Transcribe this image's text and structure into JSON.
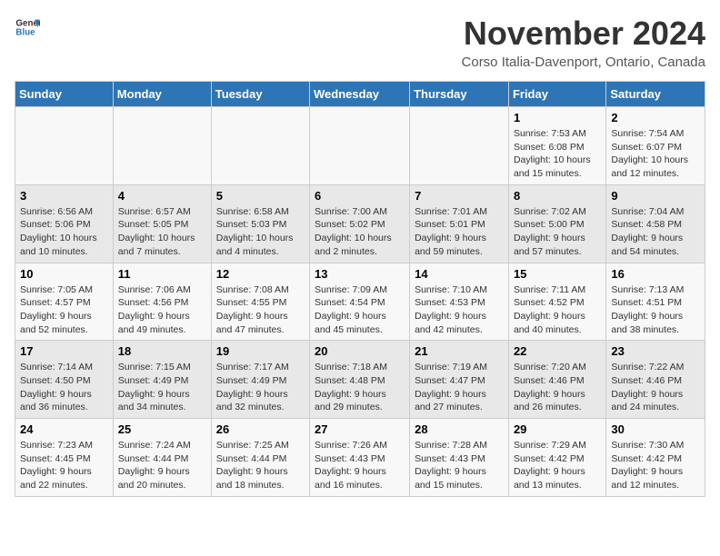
{
  "header": {
    "logo_line1": "General",
    "logo_line2": "Blue",
    "month_title": "November 2024",
    "subtitle": "Corso Italia-Davenport, Ontario, Canada"
  },
  "weekdays": [
    "Sunday",
    "Monday",
    "Tuesday",
    "Wednesday",
    "Thursday",
    "Friday",
    "Saturday"
  ],
  "weeks": [
    [
      {
        "day": "",
        "info": ""
      },
      {
        "day": "",
        "info": ""
      },
      {
        "day": "",
        "info": ""
      },
      {
        "day": "",
        "info": ""
      },
      {
        "day": "",
        "info": ""
      },
      {
        "day": "1",
        "info": "Sunrise: 7:53 AM\nSunset: 6:08 PM\nDaylight: 10 hours and 15 minutes."
      },
      {
        "day": "2",
        "info": "Sunrise: 7:54 AM\nSunset: 6:07 PM\nDaylight: 10 hours and 12 minutes."
      }
    ],
    [
      {
        "day": "3",
        "info": "Sunrise: 6:56 AM\nSunset: 5:06 PM\nDaylight: 10 hours and 10 minutes."
      },
      {
        "day": "4",
        "info": "Sunrise: 6:57 AM\nSunset: 5:05 PM\nDaylight: 10 hours and 7 minutes."
      },
      {
        "day": "5",
        "info": "Sunrise: 6:58 AM\nSunset: 5:03 PM\nDaylight: 10 hours and 4 minutes."
      },
      {
        "day": "6",
        "info": "Sunrise: 7:00 AM\nSunset: 5:02 PM\nDaylight: 10 hours and 2 minutes."
      },
      {
        "day": "7",
        "info": "Sunrise: 7:01 AM\nSunset: 5:01 PM\nDaylight: 9 hours and 59 minutes."
      },
      {
        "day": "8",
        "info": "Sunrise: 7:02 AM\nSunset: 5:00 PM\nDaylight: 9 hours and 57 minutes."
      },
      {
        "day": "9",
        "info": "Sunrise: 7:04 AM\nSunset: 4:58 PM\nDaylight: 9 hours and 54 minutes."
      }
    ],
    [
      {
        "day": "10",
        "info": "Sunrise: 7:05 AM\nSunset: 4:57 PM\nDaylight: 9 hours and 52 minutes."
      },
      {
        "day": "11",
        "info": "Sunrise: 7:06 AM\nSunset: 4:56 PM\nDaylight: 9 hours and 49 minutes."
      },
      {
        "day": "12",
        "info": "Sunrise: 7:08 AM\nSunset: 4:55 PM\nDaylight: 9 hours and 47 minutes."
      },
      {
        "day": "13",
        "info": "Sunrise: 7:09 AM\nSunset: 4:54 PM\nDaylight: 9 hours and 45 minutes."
      },
      {
        "day": "14",
        "info": "Sunrise: 7:10 AM\nSunset: 4:53 PM\nDaylight: 9 hours and 42 minutes."
      },
      {
        "day": "15",
        "info": "Sunrise: 7:11 AM\nSunset: 4:52 PM\nDaylight: 9 hours and 40 minutes."
      },
      {
        "day": "16",
        "info": "Sunrise: 7:13 AM\nSunset: 4:51 PM\nDaylight: 9 hours and 38 minutes."
      }
    ],
    [
      {
        "day": "17",
        "info": "Sunrise: 7:14 AM\nSunset: 4:50 PM\nDaylight: 9 hours and 36 minutes."
      },
      {
        "day": "18",
        "info": "Sunrise: 7:15 AM\nSunset: 4:49 PM\nDaylight: 9 hours and 34 minutes."
      },
      {
        "day": "19",
        "info": "Sunrise: 7:17 AM\nSunset: 4:49 PM\nDaylight: 9 hours and 32 minutes."
      },
      {
        "day": "20",
        "info": "Sunrise: 7:18 AM\nSunset: 4:48 PM\nDaylight: 9 hours and 29 minutes."
      },
      {
        "day": "21",
        "info": "Sunrise: 7:19 AM\nSunset: 4:47 PM\nDaylight: 9 hours and 27 minutes."
      },
      {
        "day": "22",
        "info": "Sunrise: 7:20 AM\nSunset: 4:46 PM\nDaylight: 9 hours and 26 minutes."
      },
      {
        "day": "23",
        "info": "Sunrise: 7:22 AM\nSunset: 4:46 PM\nDaylight: 9 hours and 24 minutes."
      }
    ],
    [
      {
        "day": "24",
        "info": "Sunrise: 7:23 AM\nSunset: 4:45 PM\nDaylight: 9 hours and 22 minutes."
      },
      {
        "day": "25",
        "info": "Sunrise: 7:24 AM\nSunset: 4:44 PM\nDaylight: 9 hours and 20 minutes."
      },
      {
        "day": "26",
        "info": "Sunrise: 7:25 AM\nSunset: 4:44 PM\nDaylight: 9 hours and 18 minutes."
      },
      {
        "day": "27",
        "info": "Sunrise: 7:26 AM\nSunset: 4:43 PM\nDaylight: 9 hours and 16 minutes."
      },
      {
        "day": "28",
        "info": "Sunrise: 7:28 AM\nSunset: 4:43 PM\nDaylight: 9 hours and 15 minutes."
      },
      {
        "day": "29",
        "info": "Sunrise: 7:29 AM\nSunset: 4:42 PM\nDaylight: 9 hours and 13 minutes."
      },
      {
        "day": "30",
        "info": "Sunrise: 7:30 AM\nSunset: 4:42 PM\nDaylight: 9 hours and 12 minutes."
      }
    ]
  ]
}
